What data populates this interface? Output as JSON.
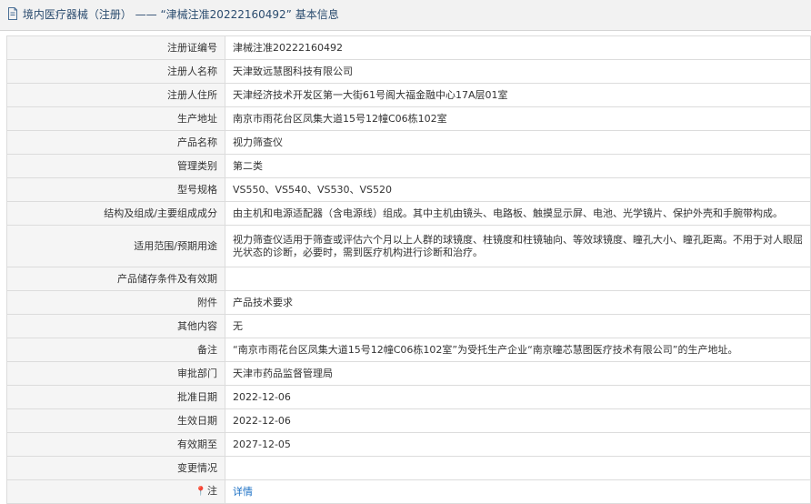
{
  "header": {
    "title": "境内医疗器械（注册） —— “津械注准20222160492” 基本信息"
  },
  "rows": [
    {
      "label": "注册证编号",
      "value": "津械注准20222160492"
    },
    {
      "label": "注册人名称",
      "value": "天津致远慧图科技有限公司"
    },
    {
      "label": "注册人住所",
      "value": "天津经济技术开发区第一大街61号阁大福金融中心17A层01室"
    },
    {
      "label": "生产地址",
      "value": "南京市雨花台区凤集大道15号12幢C06栋102室"
    },
    {
      "label": "产品名称",
      "value": "视力筛查仪"
    },
    {
      "label": "管理类别",
      "value": "第二类"
    },
    {
      "label": "型号规格",
      "value": "VS550、VS540、VS530、VS520"
    },
    {
      "label": "结构及组成/主要组成成分",
      "value": "由主机和电源适配器（含电源线）组成。其中主机由镜头、电路板、触摸显示屏、电池、光学镜片、保护外壳和手腕带构成。"
    },
    {
      "label": "适用范围/预期用途",
      "value": "视力筛查仪适用于筛查或评估六个月以上人群的球镜度、柱镜度和柱镜轴向、等效球镜度、瞳孔大小、瞳孔距离。不用于对人眼屈光状态的诊断，必要时，需到医疗机构进行诊断和治疗。"
    },
    {
      "label": "产品储存条件及有效期",
      "value": ""
    },
    {
      "label": "附件",
      "value": "产品技术要求"
    },
    {
      "label": "其他内容",
      "value": "无"
    },
    {
      "label": "备注",
      "value": "“南京市雨花台区凤集大道15号12幢C06栋102室”为受托生产企业“南京瞳芯慧图医疗技术有限公司”的生产地址。"
    },
    {
      "label": "审批部门",
      "value": "天津市药品监督管理局"
    },
    {
      "label": "批准日期",
      "value": "2022-12-06"
    },
    {
      "label": "生效日期",
      "value": "2022-12-06"
    },
    {
      "label": "有效期至",
      "value": "2027-12-05"
    },
    {
      "label": "变更情况",
      "value": ""
    }
  ],
  "note": {
    "label": "注",
    "icon": "pin-icon",
    "link_text": "详情"
  }
}
